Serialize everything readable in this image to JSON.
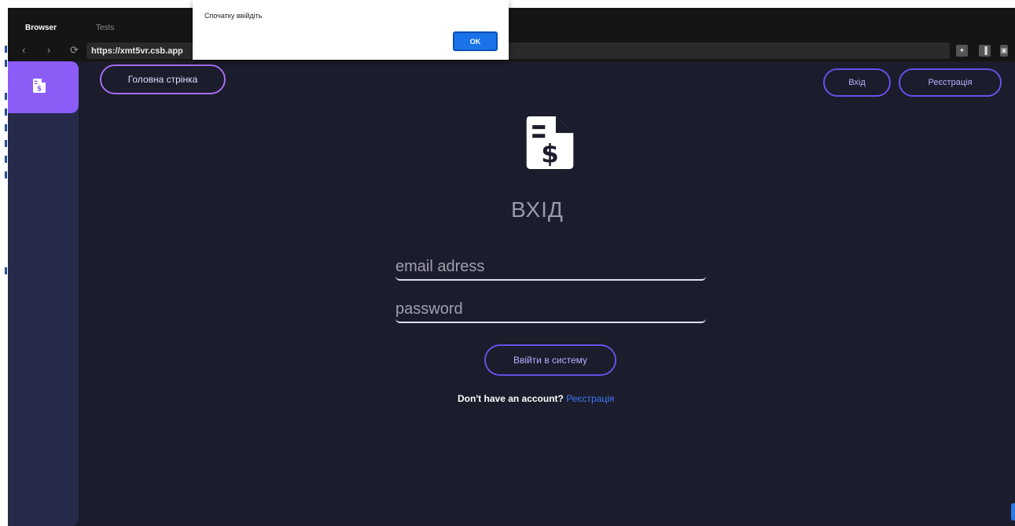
{
  "ide": {
    "tabs": [
      {
        "label": "Browser",
        "active": true
      },
      {
        "label": "Tests",
        "active": false
      }
    ],
    "url": "https://xmt5vr.csb.app"
  },
  "alert": {
    "message": "Спочатку ввійдіть",
    "ok_label": "OK"
  },
  "nav": {
    "home_label": "Головна стрінка",
    "login_label": "Вхід",
    "register_label": "Реєстрація"
  },
  "login": {
    "title": "ВХІД",
    "email_placeholder": "email adress",
    "password_placeholder": "password",
    "submit_label": "Ввійти в систему",
    "signup_prompt": "Don't have an account?",
    "signup_link": "Реєстрація"
  },
  "icons": {
    "sidebar_icon": "invoice-dollar-icon",
    "logo_icon": "invoice-dollar-icon"
  },
  "colors": {
    "accent": "#8b5cf6",
    "background": "#1b1c2c",
    "sidebar": "#262b4c",
    "link": "#3d7cf5",
    "dialog_button": "#1a73e8"
  }
}
